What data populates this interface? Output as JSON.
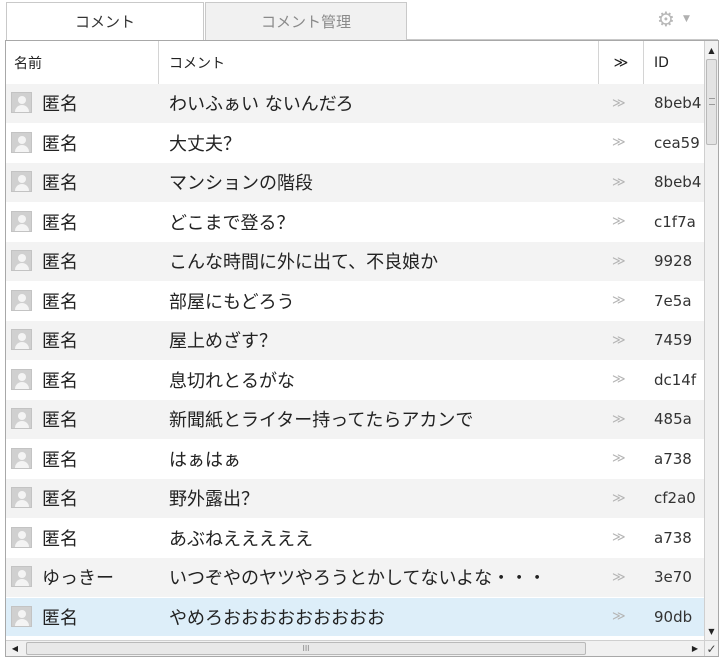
{
  "tabs": [
    {
      "label": "コメント",
      "active": true
    },
    {
      "label": "コメント管理",
      "active": false
    }
  ],
  "settings": {
    "icon": "gear-icon",
    "caret": "⌄"
  },
  "header": {
    "name": "名前",
    "comment": "コメント",
    "arrow": "≫",
    "id": "ID"
  },
  "rows": [
    {
      "name": "匿名",
      "comment": "わいふぁい ないんだろ",
      "arrow": "≫",
      "id": "8beb4",
      "style": "alt"
    },
    {
      "name": "匿名",
      "comment": "大丈夫？",
      "arrow": "≫",
      "id": "cea59",
      "style": "plain"
    },
    {
      "name": "匿名",
      "comment": "マンションの階段",
      "arrow": "≫",
      "id": "8beb4",
      "style": "alt"
    },
    {
      "name": "匿名",
      "comment": "どこまで登る？",
      "arrow": "≫",
      "id": "c1f7a",
      "style": "plain"
    },
    {
      "name": "匿名",
      "comment": "こんな時間に外に出て、不良娘か",
      "arrow": "≫",
      "id": "9928",
      "style": "alt"
    },
    {
      "name": "匿名",
      "comment": "部屋にもどろう",
      "arrow": "≫",
      "id": "7e5a",
      "style": "plain"
    },
    {
      "name": "匿名",
      "comment": "屋上めざす？",
      "arrow": "≫",
      "id": "7459",
      "style": "alt"
    },
    {
      "name": "匿名",
      "comment": "息切れとるがな",
      "arrow": "≫",
      "id": "dc14f",
      "style": "plain"
    },
    {
      "name": "匿名",
      "comment": "新聞紙とライター持ってたらアカンで",
      "arrow": "≫",
      "id": "485a",
      "style": "alt"
    },
    {
      "name": "匿名",
      "comment": "はぁはぁ",
      "arrow": "≫",
      "id": "a738",
      "style": "plain"
    },
    {
      "name": "匿名",
      "comment": "野外露出？",
      "arrow": "≫",
      "id": "cf2a0",
      "style": "alt"
    },
    {
      "name": "匿名",
      "comment": "あぶねえええええ",
      "arrow": "≫",
      "id": "a738",
      "style": "plain"
    },
    {
      "name": "ゆっきー",
      "comment": "いつぞやのヤツやろうとかしてないよな・・・",
      "arrow": "≫",
      "id": "3e70",
      "style": "alt"
    },
    {
      "name": "匿名",
      "comment": "やめろおおおおおおおおお",
      "arrow": "≫",
      "id": "90db",
      "style": "sel"
    }
  ],
  "scroll": {
    "up": "▲",
    "down": "▼",
    "left": "◀",
    "right": "▶",
    "grip": "III",
    "corner": "✓"
  }
}
